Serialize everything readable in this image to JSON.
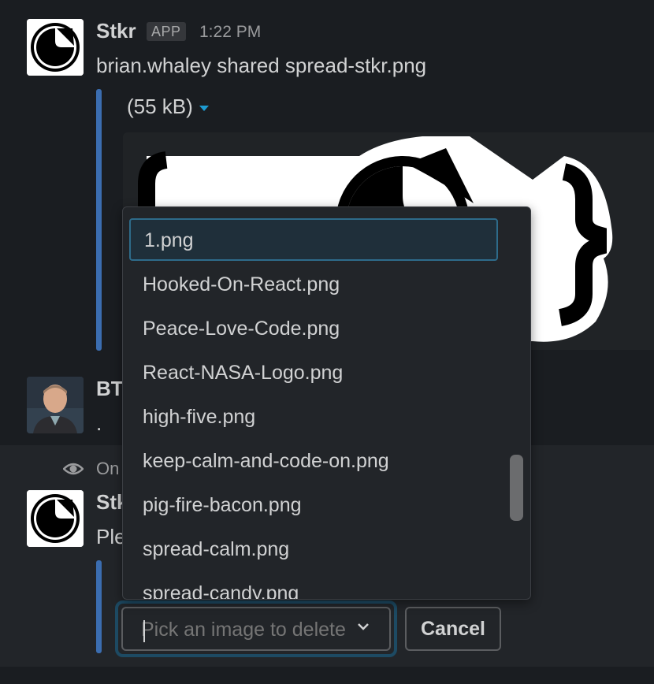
{
  "message1": {
    "sender": "Stkr",
    "badge": "APP",
    "time": "1:22 PM",
    "text": "brian.whaley shared spread-stkr.png",
    "file_size": "(55 kB)"
  },
  "message2": {
    "sender_partial": "BT",
    "text_partial": "."
  },
  "ephemeral": {
    "visibility_partial": "On",
    "sender_partial": "Stk",
    "text_partial": "Ple"
  },
  "dropdown": {
    "items": [
      "1.png",
      "Hooked-On-React.png",
      "Peace-Love-Code.png",
      "React-NASA-Logo.png",
      "high-five.png",
      "keep-calm-and-code-on.png",
      "pig-fire-bacon.png",
      "spread-calm.png",
      "spread-candy.png"
    ],
    "selected_index": 0
  },
  "select": {
    "placeholder": "Pick an image to delete"
  },
  "cancel_label": "Cancel",
  "colors": {
    "background": "#1a1d21",
    "quote_bar": "#3b6db0",
    "focus_ring": "#1d4a63",
    "caret": "#1d9bd1"
  }
}
